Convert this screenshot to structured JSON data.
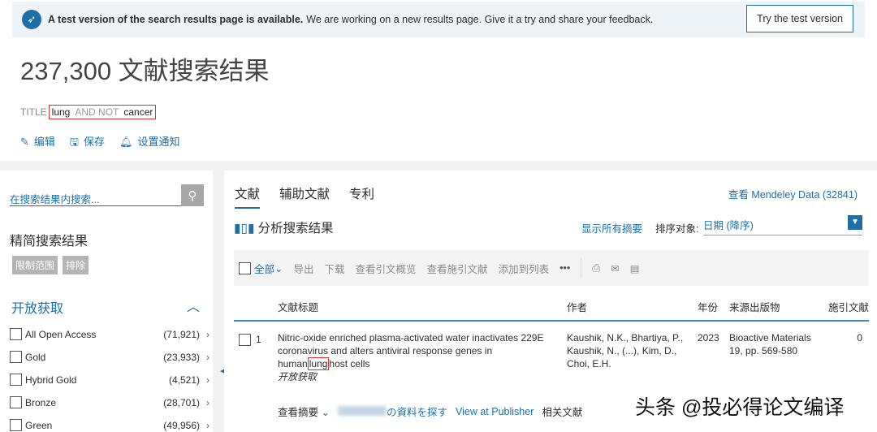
{
  "banner": {
    "bold": "A test version of the search results page is available.",
    "text": "We are working on a new results page. Give it a try and share your feedback.",
    "button": "Try the test version"
  },
  "header": {
    "title": "237,300 文献搜索结果",
    "query_field": "TITLE",
    "query_open": "(",
    "query_term1": "lung",
    "query_op": "AND NOT",
    "query_term2": "cancer",
    "query_close": ")",
    "actions": [
      "编辑",
      "保存",
      "设置通知"
    ]
  },
  "sidebar": {
    "search_placeholder": "在搜索结果内搜索...",
    "refine_title": "精简搜索结果",
    "limit": "限制范围",
    "exclude": "排除",
    "open_access_title": "开放获取",
    "facets": [
      {
        "label": "All Open Access",
        "count": "(71,921)"
      },
      {
        "label": "Gold",
        "count": "(23,933)"
      },
      {
        "label": "Hybrid Gold",
        "count": "(4,521)"
      },
      {
        "label": "Bronze",
        "count": "(28,701)"
      },
      {
        "label": "Green",
        "count": "(49,956)"
      }
    ]
  },
  "main": {
    "tabs": [
      "文献",
      "辅助文献",
      "专利"
    ],
    "mendeley": "查看 Mendeley Data (32841)",
    "analyze": "分析搜索结果",
    "show_all_abstracts": "显示所有摘要",
    "sort_label": "排序对象:",
    "sort_value": "日期 (降序)",
    "toolbar": {
      "all": "全部",
      "export": "导出",
      "download": "下载",
      "citation_overview": "查看引文概览",
      "cited_by": "查看施引文献",
      "add_to_list": "添加到列表",
      "more": "•••"
    },
    "columns": [
      "文献标题",
      "作者",
      "年份",
      "来源出版物",
      "施引文献"
    ],
    "results": [
      {
        "num": "1",
        "title_pre": "Nitric-oxide enriched plasma-activated water inactivates 229E coronavirus and alters antiviral response genes in human",
        "title_hl": "lung",
        "title_post": "host cells",
        "access": "开放获取",
        "authors": "Kaushik, N.K., Bhartiya, P., Kaushik, N., (...), Kim, D., Choi, E.H.",
        "year": "2023",
        "source": "Bioactive Materials 19, pp. 569-580",
        "cited": "0",
        "links": {
          "abstract": "查看摘要",
          "find": "の資料を探す",
          "publisher": "View at Publisher",
          "related": "相关文献"
        }
      }
    ]
  },
  "watermark": "头条 @投必得论文编译",
  "colors": {
    "accent": "#1e6fa8",
    "highlight": "#dd3333"
  }
}
